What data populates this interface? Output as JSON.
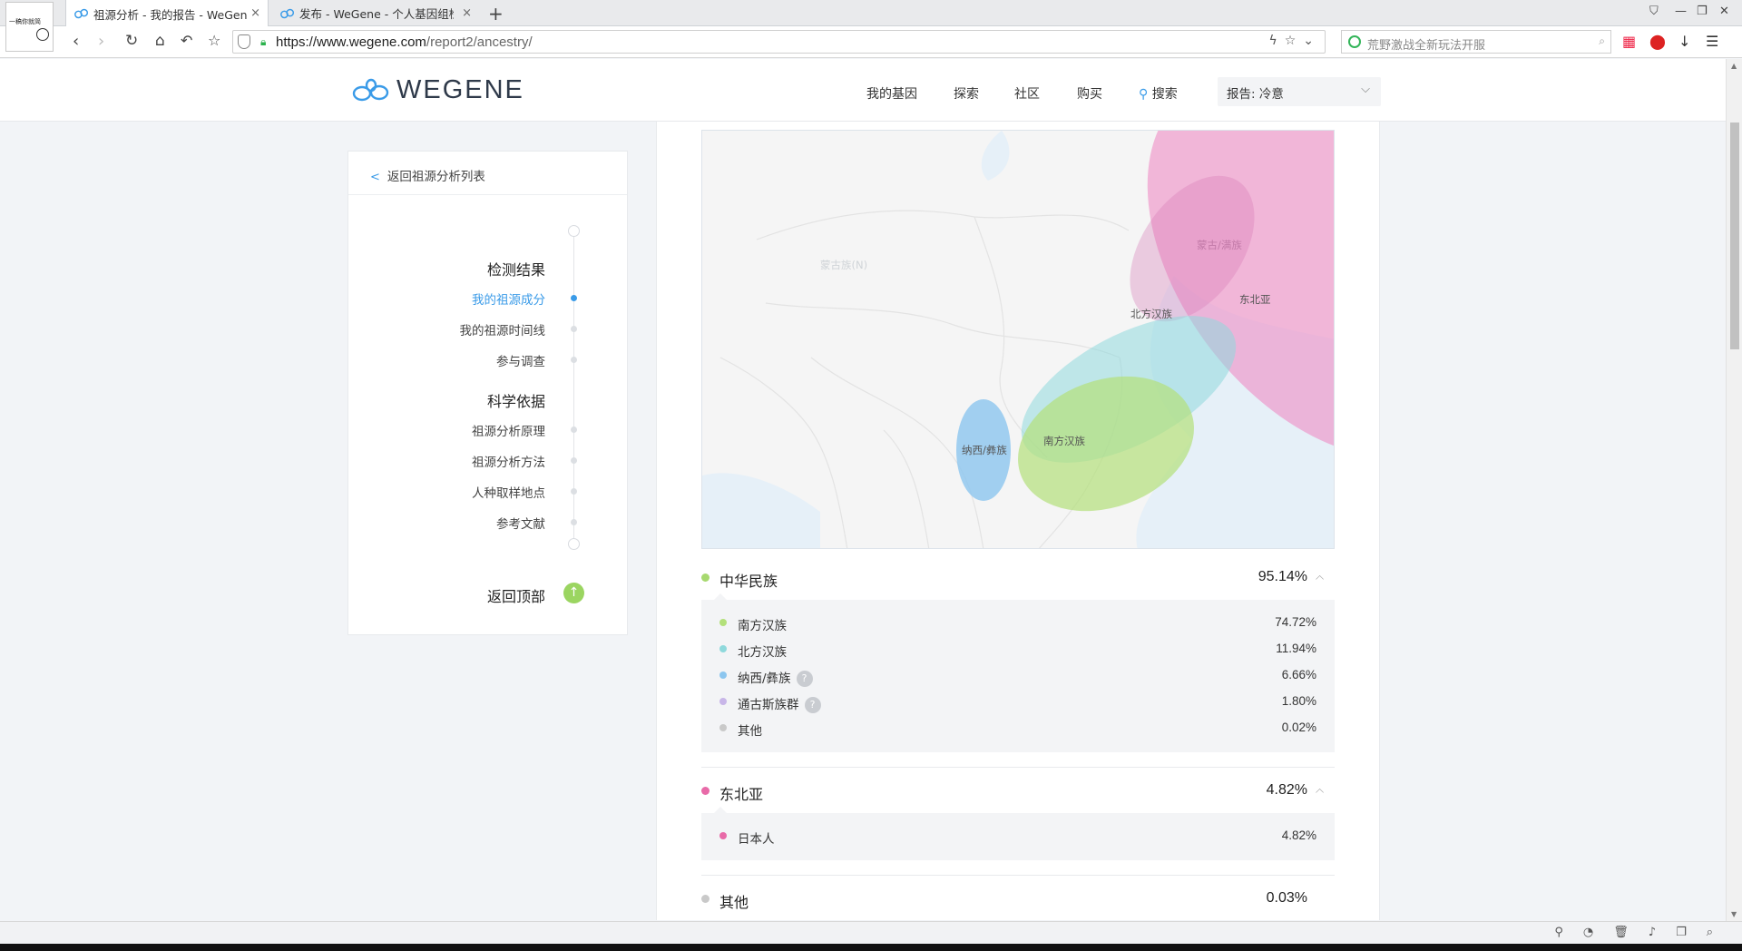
{
  "browser": {
    "tabs": [
      {
        "label": "祖源分析 - 我的报告 - WeGene",
        "close": "×"
      },
      {
        "label": "发布 - WeGene - 个人基因组检",
        "close": "×"
      }
    ],
    "new_tab": "+",
    "avatar_caption": "一稿你就简",
    "url_main": "https://www.wegene.com",
    "url_path": "/report2/ancestry/",
    "search_placeholder": "荒野激战全新玩法开服"
  },
  "header": {
    "logo_text": "WEGENE",
    "nav": [
      "我的基因",
      "探索",
      "社区",
      "购买"
    ],
    "search_label": "搜索",
    "report_select": "报告: 冷意"
  },
  "sidebar": {
    "back_link": "返回祖源分析列表",
    "sections": [
      {
        "title": "检测结果",
        "items": [
          "我的祖源成分",
          "我的祖源时间线",
          "参与调查"
        ]
      },
      {
        "title": "科学依据",
        "items": [
          "祖源分析原理",
          "祖源分析方法",
          "人种取样地点",
          "参考文献"
        ]
      }
    ],
    "back_to_top": "返回顶部"
  },
  "map": {
    "labels": {
      "south_han": "南方汉族",
      "north_han": "北方汉族",
      "naxi_yi": "纳西/彝族",
      "northeast_asia": "东北亚",
      "faint_1": "蒙古/满族",
      "faint_2": "蒙古族(N)"
    },
    "colors": {
      "south_han": "#b3e07a",
      "north_han": "#8fd9dc",
      "naxi_yi": "#8cc6ef",
      "northeast_asia": "#ef8cc4",
      "tungusic": "#c8b6e8",
      "other": "#c9c9c9"
    }
  },
  "ancestry": [
    {
      "name": "中华民族",
      "value": "95.14%",
      "color": "#a7d96f",
      "children": [
        {
          "name": "南方汉族",
          "value": "74.72%",
          "color": "#b3e07a",
          "help": false
        },
        {
          "name": "北方汉族",
          "value": "11.94%",
          "color": "#8fd9dc",
          "help": false
        },
        {
          "name": "纳西/彝族",
          "value": "6.66%",
          "color": "#8cc6ef",
          "help": true
        },
        {
          "name": "通古斯族群",
          "value": "1.80%",
          "color": "#c8b6e8",
          "help": true
        },
        {
          "name": "其他",
          "value": "0.02%",
          "color": "#c9c9c9",
          "help": false
        }
      ]
    },
    {
      "name": "东北亚",
      "value": "4.82%",
      "color": "#e86aa8",
      "children": [
        {
          "name": "日本人",
          "value": "4.82%",
          "color": "#e86aa8",
          "help": false
        }
      ]
    },
    {
      "name": "其他",
      "value": "0.03%",
      "color": "#c9c9c9",
      "children": []
    }
  ],
  "help_glyph": "?"
}
